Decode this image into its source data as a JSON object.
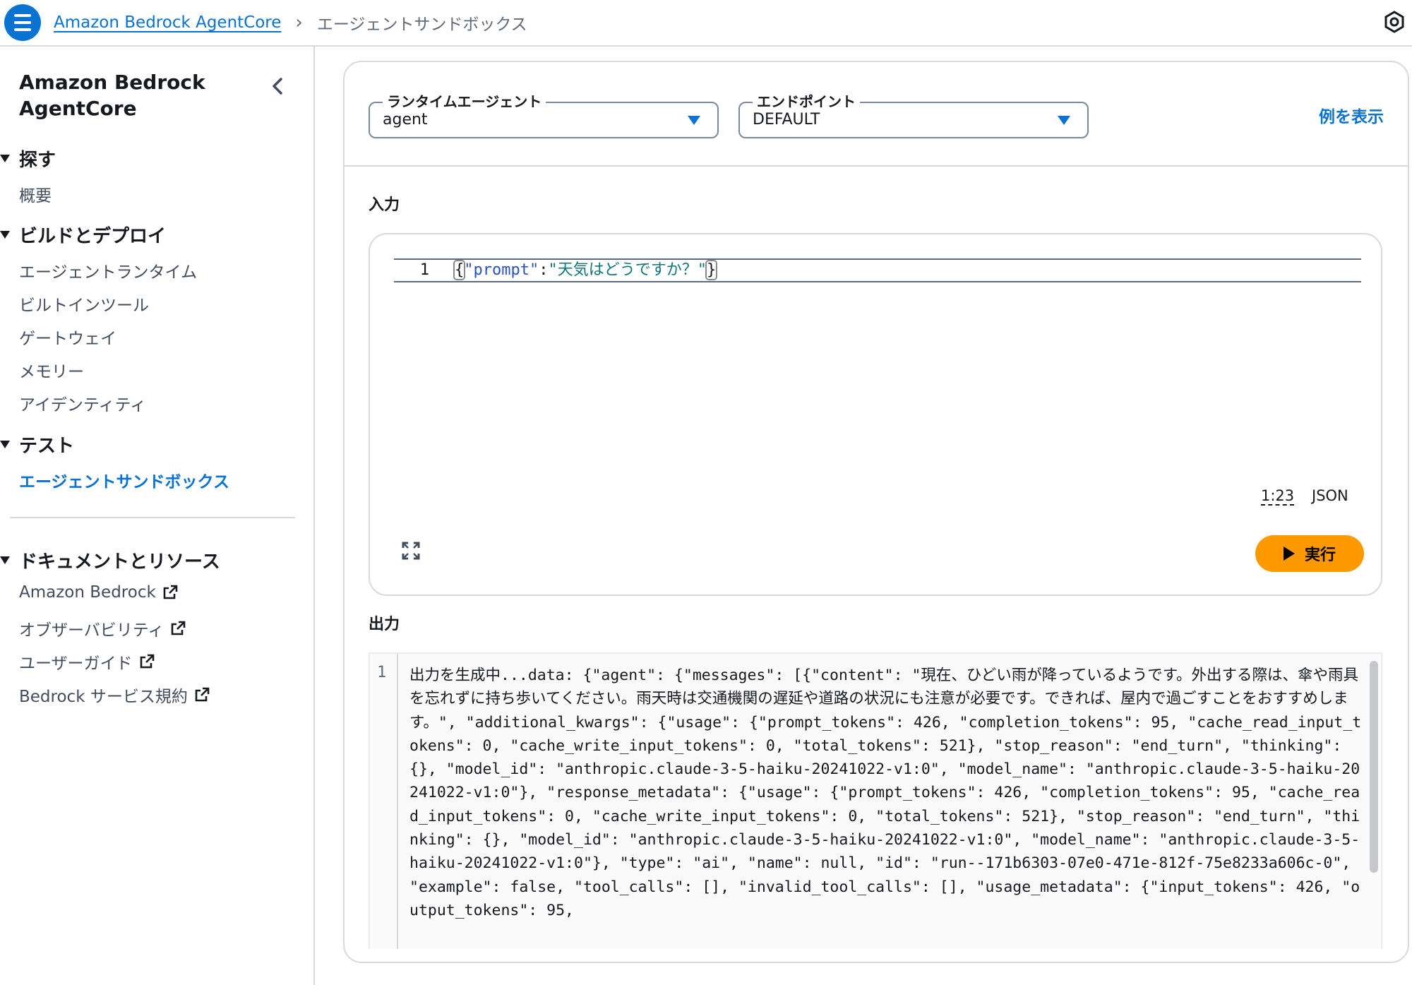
{
  "breadcrumb": {
    "root": "Amazon Bedrock AgentCore",
    "current": "エージェントサンドボックス"
  },
  "sidebar": {
    "title": "Amazon Bedrock AgentCore",
    "sections": [
      {
        "label": "探す",
        "items": [
          "概要"
        ]
      },
      {
        "label": "ビルドとデプロイ",
        "items": [
          "エージェントランタイム",
          "ビルトインツール",
          "ゲートウェイ",
          "メモリー",
          "アイデンティティ"
        ]
      },
      {
        "label": "テスト",
        "items": [
          "エージェントサンドボックス"
        ]
      },
      {
        "label": "ドキュメントとリソース",
        "items": [
          "Amazon Bedrock",
          "オブザーバビリティ",
          "ユーザーガイド",
          "Bedrock サービス規約"
        ]
      }
    ]
  },
  "form": {
    "runtime_label": "ランタイムエージェント",
    "runtime_value": "agent",
    "endpoint_label": "エンドポイント",
    "endpoint_value": "DEFAULT",
    "examples_link": "例を表示"
  },
  "input": {
    "label": "入力",
    "line_number": "1",
    "code_brace_open": "{",
    "code_key": "\"prompt\"",
    "code_colon": ":",
    "code_value": "\"天気はどうですか？\"",
    "code_brace_close": "}",
    "cursor_position": "1:23",
    "language": "JSON",
    "run_label": "実行"
  },
  "output": {
    "label": "出力",
    "line_number": "1",
    "text": "出力を生成中...data: {\"agent\": {\"messages\": [{\"content\": \"現在、ひどい雨が降っているようです。外出する際は、傘や雨具を忘れずに持ち歩いてください。雨天時は交通機関の遅延や道路の状況にも注意が必要です。できれば、屋内で過ごすことをおすすめします。\", \"additional_kwargs\": {\"usage\": {\"prompt_tokens\": 426, \"completion_tokens\": 95, \"cache_read_input_tokens\": 0, \"cache_write_input_tokens\": 0, \"total_tokens\": 521}, \"stop_reason\": \"end_turn\", \"thinking\": {}, \"model_id\": \"anthropic.claude-3-5-haiku-20241022-v1:0\", \"model_name\": \"anthropic.claude-3-5-haiku-20241022-v1:0\"}, \"response_metadata\": {\"usage\": {\"prompt_tokens\": 426, \"completion_tokens\": 95, \"cache_read_input_tokens\": 0, \"cache_write_input_tokens\": 0, \"total_tokens\": 521}, \"stop_reason\": \"end_turn\", \"thinking\": {}, \"model_id\": \"anthropic.claude-3-5-haiku-20241022-v1:0\", \"model_name\": \"anthropic.claude-3-5-haiku-20241022-v1:0\"}, \"type\": \"ai\", \"name\": null, \"id\": \"run--171b6303-07e0-471e-812f-75e8233a606c-0\", \"example\": false, \"tool_calls\": [], \"invalid_tool_calls\": [], \"usage_metadata\": {\"input_tokens\": 426, \"output_tokens\": 95,"
  },
  "colors": {
    "accent": "#0972d3",
    "run_button": "#ff9900"
  },
  "icons": {
    "menu": "hamburger-menu-icon",
    "top_right": "settings-hexagon-icon",
    "collapse": "chevron-left-icon",
    "external": "external-link-icon",
    "expand": "fullscreen-icon",
    "run": "play-icon"
  }
}
